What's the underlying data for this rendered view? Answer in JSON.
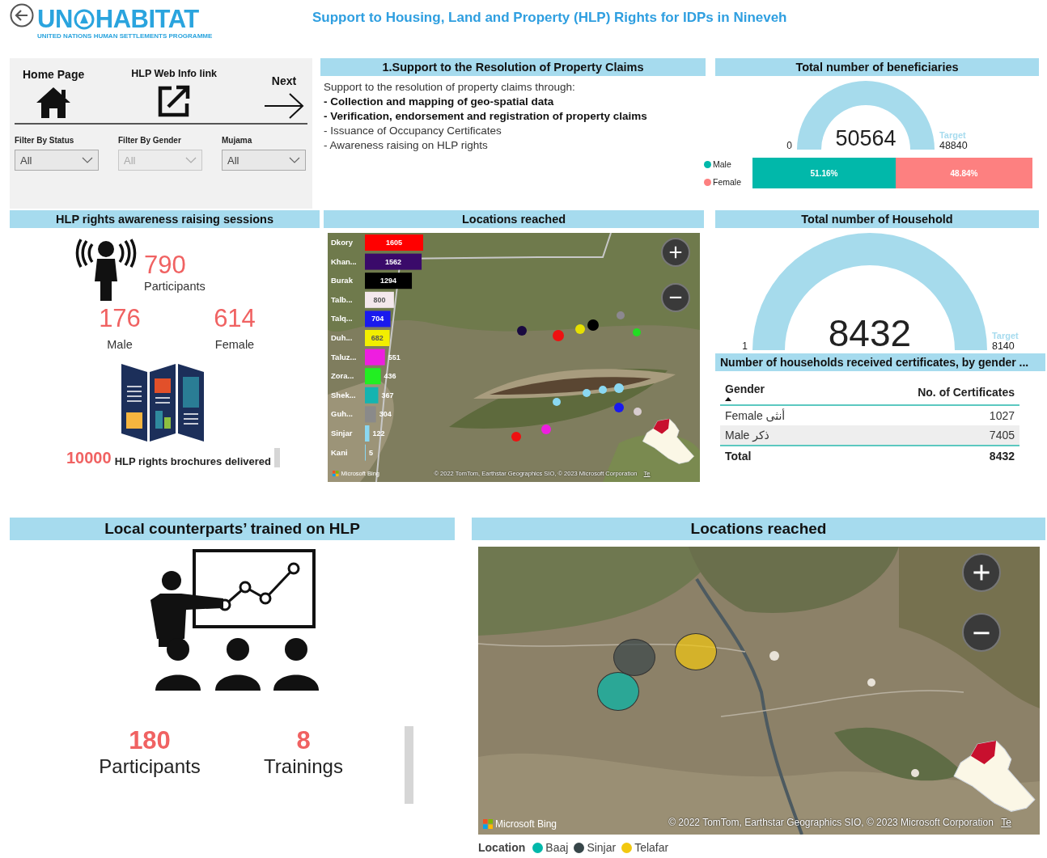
{
  "logo": {
    "left": "UN",
    "right": "HABITAT",
    "tagline": "UNITED NATIONS HUMAN SETTLEMENTS PROGRAMME"
  },
  "title": "Support to Housing, Land and Property (HLP) Rights for IDPs in Nineveh",
  "nav": {
    "links": [
      {
        "kind": "home",
        "label": "Home Page"
      },
      {
        "kind": "external",
        "label": "HLP Web Info link"
      },
      {
        "kind": "next",
        "label": "Next"
      }
    ],
    "filters": [
      {
        "label": "Filter By Status",
        "value": "All",
        "disabled": false
      },
      {
        "label": "Filter By Gender",
        "value": "All",
        "disabled": true
      },
      {
        "label": "Mujama",
        "value": "All",
        "disabled": false
      }
    ]
  },
  "claims": {
    "title": "1.Support to the Resolution of Property Claims",
    "intro": "Support to the resolution of property claims through:",
    "items": [
      {
        "text": "- Collection and mapping of geo-spatial data",
        "bold": true
      },
      {
        "text": "- Verification, endorsement and registration of property claims",
        "bold": true
      },
      {
        "text": "- Issuance of Occupancy Certificates",
        "bold": false
      },
      {
        "text": "- Awareness raising on HLP rights",
        "bold": false
      }
    ]
  },
  "beneficiaries": {
    "title": "Total number of beneficiaries",
    "gauge": {
      "min": "0",
      "value": "50564",
      "target_label": "Target",
      "target": "48840",
      "level": 1
    },
    "gender_split": [
      {
        "label": "Male",
        "share": "51.16%",
        "level": 0.5116,
        "color": "#01b8aa"
      },
      {
        "label": "Female",
        "share": "48.84%",
        "level": 0.4884,
        "color": "#fd8080"
      }
    ]
  },
  "awareness": {
    "title": "HLP rights awareness raising sessions",
    "participants": "790",
    "participants_label": "Participants",
    "male": "176",
    "male_label": "Male",
    "female": "614",
    "female_label": "Female",
    "brochures": "10000",
    "brochures_label": "HLP rights brochures delivered"
  },
  "locations_map": {
    "title": "Locations reached",
    "chart_data": {
      "type": "bar",
      "orientation": "horizontal",
      "data_labels": true,
      "categories": [
        "Dkory",
        "Khan...",
        "Burak",
        "Talb...",
        "Talq...",
        "Duh...",
        "Taluz...",
        "Zora...",
        "Shek...",
        "Guh...",
        "Sinjar",
        "Kani"
      ],
      "values": [
        1605,
        1562,
        1294,
        800,
        704,
        682,
        551,
        436,
        367,
        304,
        122,
        5
      ],
      "colors": [
        "#ff0000",
        "#3a0a6a",
        "#000000",
        "#f4e8ec",
        "#1a1aee",
        "#f2ee00",
        "#ee1ee0",
        "#22ee22",
        "#14b4b0",
        "#8a8a8a",
        "#8ad8f2",
        "#8ad8f2"
      ]
    },
    "bing_label": "Microsoft Bing",
    "attribution": "© 2022 TomTom, Earthstar Geographics SIO, © 2023 Microsoft Corporation",
    "terms_link": "Te"
  },
  "households": {
    "title": "Total number of Household",
    "gauge": {
      "min": "1",
      "value": "8432",
      "target_label": "Target",
      "target": "8140",
      "level": 1
    }
  },
  "certificates": {
    "title": "Number of households received certificates, by gender ...",
    "columns": [
      "Gender",
      "No. of Certificates"
    ],
    "rows": [
      [
        "Female أنثى",
        "1027"
      ],
      [
        "Male ذكر",
        "7405"
      ]
    ],
    "total": [
      "Total",
      "8432"
    ]
  },
  "counterparts": {
    "title": "Local counterparts’ trained on HLP",
    "stats": [
      {
        "value": "180",
        "label": "Participants"
      },
      {
        "value": "8",
        "label": "Trainings"
      }
    ]
  },
  "locations_map_2": {
    "title": "Locations reached",
    "bing_label": "Microsoft Bing",
    "attribution": "© 2022 TomTom, Earthstar Geographics SIO, © 2023 Microsoft Corporation",
    "terms_link": "Te",
    "legend": {
      "title": "Location",
      "items": [
        {
          "label": "Baaj",
          "color": "#01b8aa"
        },
        {
          "label": "Sinjar",
          "color": "#374649"
        },
        {
          "label": "Telafar",
          "color": "#f2c80f"
        }
      ]
    }
  }
}
